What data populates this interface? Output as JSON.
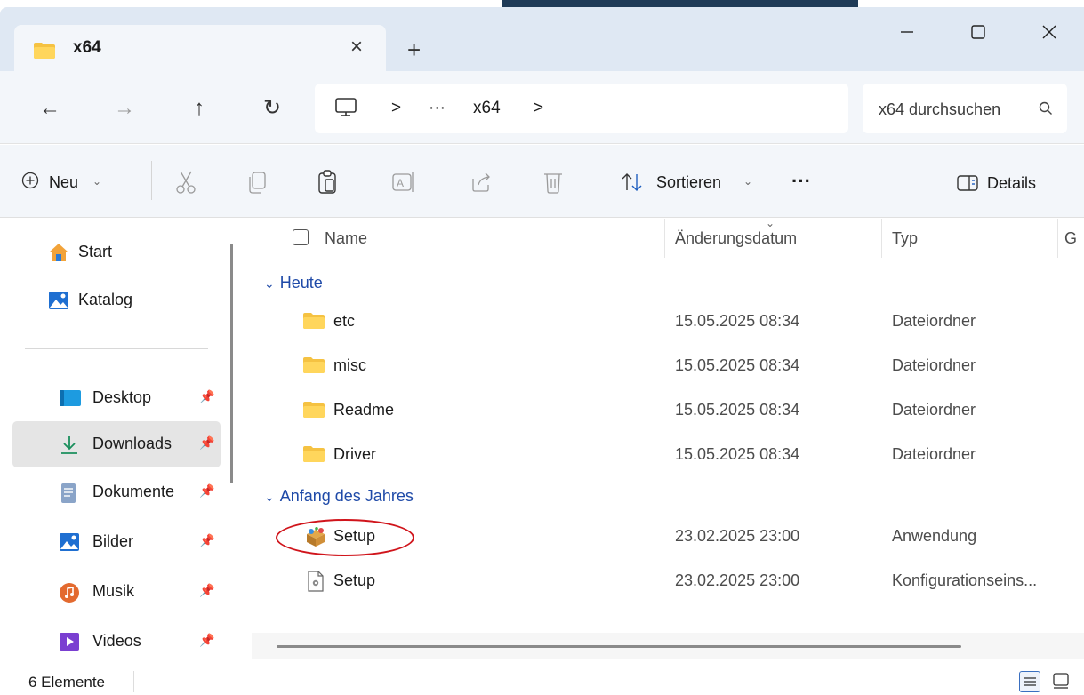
{
  "window": {
    "tab_title": "x64",
    "tab_close": "×",
    "new_tab": "+"
  },
  "nav": {
    "back": "←",
    "forward": "→",
    "up": "↑",
    "refresh": "↻",
    "breadcrumb": [
      ">",
      "···",
      "x64",
      ">"
    ],
    "search_placeholder": "x64 durchsuchen"
  },
  "toolbar": {
    "new_label": "Neu",
    "sort_label": "Sortieren",
    "more_label": "···",
    "details_label": "Details"
  },
  "sidebar": {
    "items": [
      {
        "label": "Start",
        "icon": "home-icon",
        "pinned": false,
        "active": false
      },
      {
        "label": "Katalog",
        "icon": "gallery-icon",
        "pinned": false,
        "active": false
      },
      {
        "label": "Desktop",
        "icon": "desktop-icon",
        "pinned": true,
        "active": false
      },
      {
        "label": "Downloads",
        "icon": "download-icon",
        "pinned": true,
        "active": true
      },
      {
        "label": "Dokumente",
        "icon": "documents-icon",
        "pinned": true,
        "active": false
      },
      {
        "label": "Bilder",
        "icon": "pictures-icon",
        "pinned": true,
        "active": false
      },
      {
        "label": "Musik",
        "icon": "music-icon",
        "pinned": true,
        "active": false
      },
      {
        "label": "Videos",
        "icon": "videos-icon",
        "pinned": true,
        "active": false
      }
    ]
  },
  "columns": {
    "name": "Name",
    "date": "Änderungsdatum",
    "type": "Typ",
    "size": "G"
  },
  "groups": [
    {
      "label": "Heute",
      "rows": [
        {
          "name": "etc",
          "date": "15.05.2025 08:34",
          "type": "Dateiordner",
          "icon": "folder-icon"
        },
        {
          "name": "misc",
          "date": "15.05.2025 08:34",
          "type": "Dateiordner",
          "icon": "folder-icon"
        },
        {
          "name": "Readme",
          "date": "15.05.2025 08:34",
          "type": "Dateiordner",
          "icon": "folder-icon"
        },
        {
          "name": "Driver",
          "date": "15.05.2025 08:34",
          "type": "Dateiordner",
          "icon": "folder-icon"
        }
      ]
    },
    {
      "label": "Anfang des Jahres",
      "rows": [
        {
          "name": "Setup",
          "date": "23.02.2025 23:00",
          "type": "Anwendung",
          "icon": "installer-icon"
        },
        {
          "name": "Setup",
          "date": "23.02.2025 23:00",
          "type": "Konfigurationseins...",
          "icon": "config-file-icon"
        }
      ]
    }
  ],
  "status": {
    "count": "6 Elemente"
  },
  "colors": {
    "accent": "#1f4aa8",
    "highlight_ellipse": "#d0141b",
    "folder": "#f5c242"
  }
}
